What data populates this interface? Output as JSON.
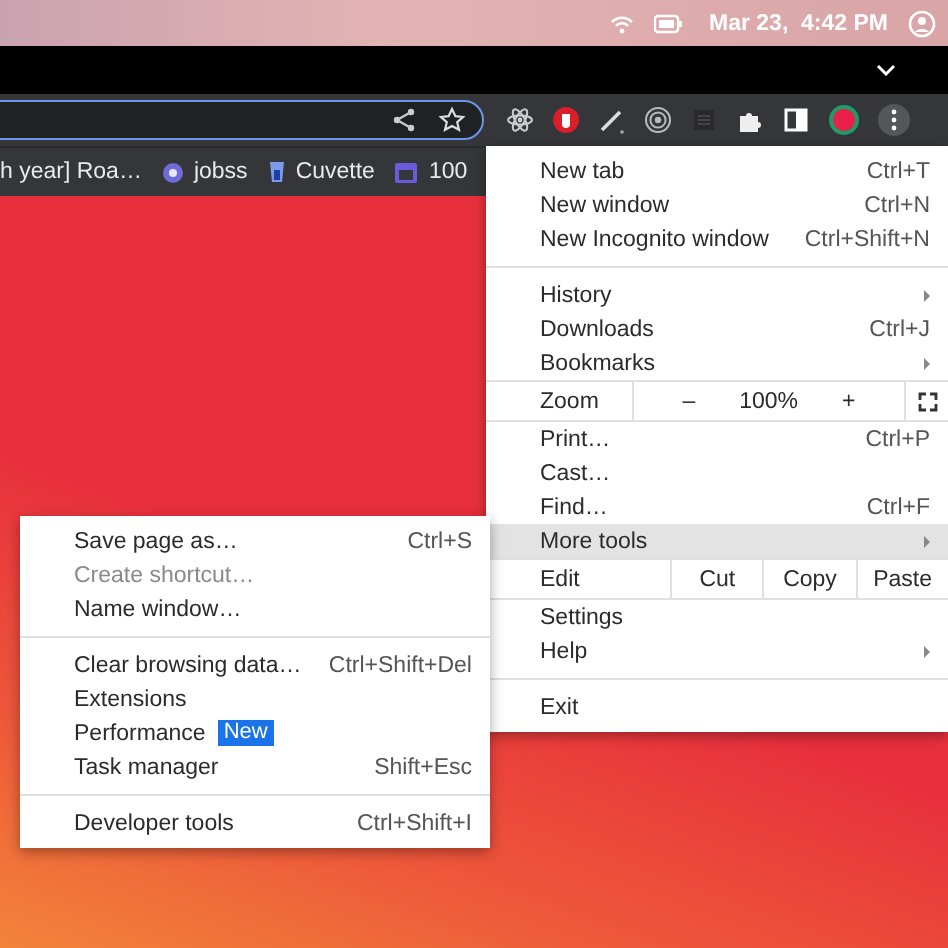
{
  "system_bar": {
    "date_time": "Mar 23,  4:42 PM"
  },
  "bookmarks": [
    {
      "label": "h year] Roa…"
    },
    {
      "label": "jobss"
    },
    {
      "label": "Cuvette"
    },
    {
      "label": "100"
    }
  ],
  "menu": [
    {
      "kind": "item",
      "label": "New tab",
      "shortcut": "Ctrl+T",
      "submenu": false,
      "highlighted": false,
      "disabled": false
    },
    {
      "kind": "item",
      "label": "New window",
      "shortcut": "Ctrl+N",
      "submenu": false,
      "highlighted": false,
      "disabled": false
    },
    {
      "kind": "item",
      "label": "New Incognito window",
      "shortcut": "Ctrl+Shift+N",
      "submenu": false,
      "highlighted": false,
      "disabled": false
    },
    {
      "kind": "separator"
    },
    {
      "kind": "item",
      "label": "History",
      "submenu": true,
      "highlighted": false,
      "disabled": false
    },
    {
      "kind": "item",
      "label": "Downloads",
      "shortcut": "Ctrl+J",
      "submenu": false,
      "highlighted": false,
      "disabled": false
    },
    {
      "kind": "item",
      "label": "Bookmarks",
      "submenu": true,
      "highlighted": false,
      "disabled": false
    },
    {
      "kind": "zoom",
      "label": "Zoom",
      "minus": "–",
      "value": "100%",
      "plus": "+"
    },
    {
      "kind": "item",
      "label": "Print…",
      "shortcut": "Ctrl+P",
      "submenu": false,
      "highlighted": false,
      "disabled": false
    },
    {
      "kind": "item",
      "label": "Cast…",
      "submenu": false,
      "highlighted": false,
      "disabled": false
    },
    {
      "kind": "item",
      "label": "Find…",
      "shortcut": "Ctrl+F",
      "submenu": false,
      "highlighted": false,
      "disabled": false
    },
    {
      "kind": "item",
      "label": "More tools",
      "submenu": true,
      "highlighted": true,
      "disabled": false
    },
    {
      "kind": "edit",
      "label": "Edit",
      "buttons": [
        "Cut",
        "Copy",
        "Paste"
      ]
    },
    {
      "kind": "item",
      "label": "Settings",
      "submenu": false,
      "highlighted": false,
      "disabled": false
    },
    {
      "kind": "item",
      "label": "Help",
      "submenu": true,
      "highlighted": false,
      "disabled": false
    },
    {
      "kind": "separator"
    },
    {
      "kind": "item",
      "label": "Exit",
      "submenu": false,
      "highlighted": false,
      "disabled": false
    }
  ],
  "submenu": [
    {
      "kind": "item",
      "label": "Save page as…",
      "shortcut": "Ctrl+S",
      "disabled": false
    },
    {
      "kind": "item",
      "label": "Create shortcut…",
      "disabled": true
    },
    {
      "kind": "item",
      "label": "Name window…",
      "disabled": false
    },
    {
      "kind": "separator"
    },
    {
      "kind": "item",
      "label": "Clear browsing data…",
      "shortcut": "Ctrl+Shift+Del",
      "disabled": false
    },
    {
      "kind": "item",
      "label": "Extensions",
      "disabled": false
    },
    {
      "kind": "item",
      "label": "Performance",
      "badge": "New",
      "disabled": false
    },
    {
      "kind": "item",
      "label": "Task manager",
      "shortcut": "Shift+Esc",
      "disabled": false
    },
    {
      "kind": "separator"
    },
    {
      "kind": "item",
      "label": "Developer tools",
      "shortcut": "Ctrl+Shift+I",
      "disabled": false
    }
  ]
}
